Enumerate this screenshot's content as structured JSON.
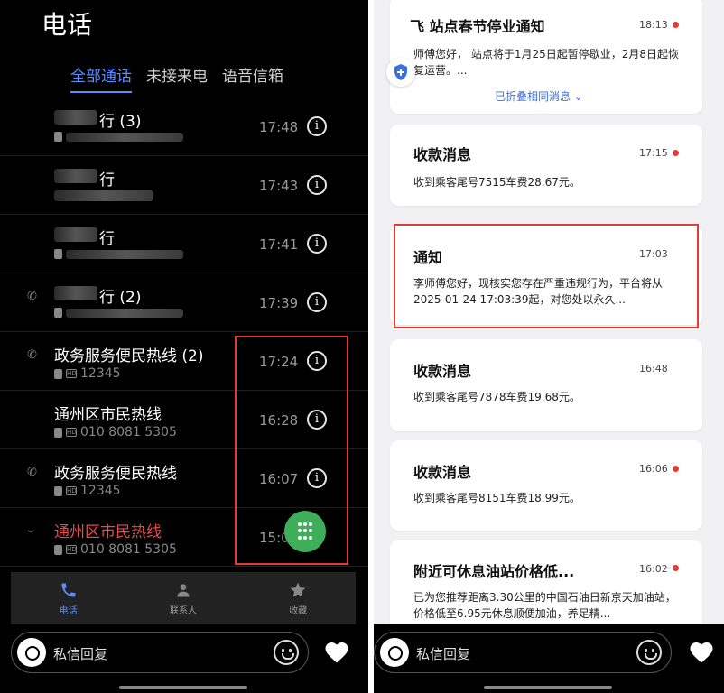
{
  "left": {
    "title": "电话",
    "tabs": [
      "全部通话",
      "未接来电",
      "语音信箱"
    ],
    "calls": [
      {
        "name": "行 (3)",
        "sub": "0851 717 7090",
        "time": "17:48",
        "dir": "",
        "blurred": true
      },
      {
        "name": "行",
        "sub": "",
        "time": "17:43",
        "dir": "",
        "blurred": true
      },
      {
        "name": "行",
        "sub": "0851 717 7093",
        "time": "17:41",
        "dir": "",
        "blurred": true
      },
      {
        "name": "行 (2)",
        "sub": "0851 717 7090",
        "time": "17:39",
        "dir": "outgoing",
        "blurred": true
      },
      {
        "name": "政务服务便民热线 (2)",
        "sub": "12345",
        "time": "17:24",
        "dir": "outgoing",
        "blurred": false
      },
      {
        "name": "通州区市民热线",
        "sub": "010 8081 5305",
        "time": "16:28",
        "dir": "",
        "blurred": false
      },
      {
        "name": "政务服务便民热线",
        "sub": "12345",
        "time": "16:07",
        "dir": "outgoing",
        "blurred": false
      },
      {
        "name": "通州区市民热线",
        "sub": "010 8081 5305",
        "time": "15:0",
        "dir": "missed",
        "blurred": false
      }
    ],
    "nav": [
      {
        "label": "电话",
        "icon": "phone-icon",
        "active": true
      },
      {
        "label": "联系人",
        "icon": "contacts-icon",
        "active": false
      },
      {
        "label": "收藏",
        "icon": "star-icon",
        "active": false
      }
    ],
    "reply_placeholder": "私信回复"
  },
  "right": {
    "cards": [
      {
        "title": "飞 站点春节停业通知",
        "time": "18:13",
        "unread": true,
        "body": "师傅您好， 站点将于1月25日起暂停歇业，2月8日起恢复运营。...",
        "fold": "已折叠相同消息 ⌄"
      },
      {
        "title": "收款消息",
        "time": "17:15",
        "unread": true,
        "body": "收到乘客尾号7515车费28.67元。"
      },
      {
        "title": "通知",
        "time": "17:03",
        "unread": false,
        "body": "李师傅您好，现核实您存在严重违规行为，平台将从2025-01-24 17:03:39起，对您处以永久..."
      },
      {
        "title": "收款消息",
        "time": "16:48",
        "unread": false,
        "body": "收到乘客尾号7878车费19.68元。"
      },
      {
        "title": "收款消息",
        "time": "16:06",
        "unread": true,
        "body": "收到乘客尾号8151车费18.99元。"
      },
      {
        "title": "附近可休息油站价格低...",
        "time": "16:02",
        "unread": true,
        "body": "已为您推荐距离3.30公里的中国石油日新京天加油站，价格低至6.95元休息顺便加油，养足精..."
      }
    ],
    "reply_placeholder": "私信回复"
  },
  "colors": {
    "accent": "#5b8dff",
    "highlight": "#e53935",
    "fab": "#3fae5a",
    "missed": "#e84a4a"
  }
}
